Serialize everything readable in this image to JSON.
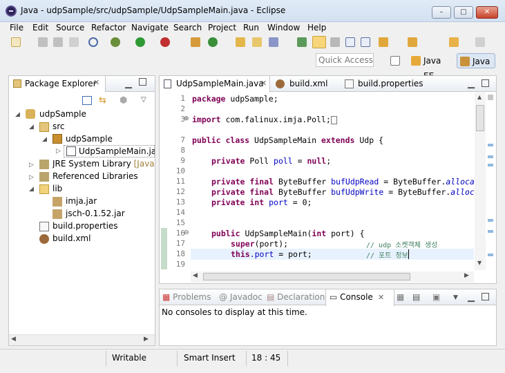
{
  "window": {
    "title": "Java - udpSample/src/udpSample/UdpSampleMain.java - Eclipse",
    "min": "–",
    "max": "□",
    "close": "✕"
  },
  "menu": [
    "File",
    "Edit",
    "Source",
    "Refactor",
    "Navigate",
    "Search",
    "Project",
    "Run",
    "Window",
    "Help"
  ],
  "quick_access": {
    "placeholder": "Quick Access"
  },
  "perspectives": [
    {
      "label": "Java EE"
    },
    {
      "label": "Java"
    }
  ],
  "package_explorer": {
    "title": "Package Explorer",
    "tree": [
      {
        "label": "udpSample"
      },
      {
        "label": "src"
      },
      {
        "label": "udpSample"
      },
      {
        "label": "UdpSampleMain.java"
      },
      {
        "label": "JRE System Library",
        "suffix": "[JavaSE-"
      },
      {
        "label": "Referenced Libraries"
      },
      {
        "label": "lib"
      },
      {
        "label": "imja.jar"
      },
      {
        "label": "jsch-0.1.52.jar"
      },
      {
        "label": "build.properties"
      },
      {
        "label": "build.xml"
      }
    ]
  },
  "editor": {
    "tabs": [
      {
        "label": "UdpSampleMain.java"
      },
      {
        "label": "build.xml"
      },
      {
        "label": "build.properties"
      }
    ],
    "line_numbers": [
      "1",
      "2",
      "3",
      "7",
      "8",
      "9",
      "10",
      "11",
      "12",
      "13",
      "14",
      "15",
      "16",
      "17",
      "18",
      "19"
    ],
    "code": {
      "l1_kw": "package",
      "l1_rest": " udpSample;",
      "l3_kw": "import",
      "l3_rest": " com.falinux.imja.Poll;",
      "l7_kw1": "public",
      "l7_kw2": "class",
      "l7_name": " UdpSampleMain ",
      "l7_kw3": "extends",
      "l7_rest": " Udp {",
      "l9_kw": "private",
      "l9_type": " Poll ",
      "l9_fld": "poll",
      "l9_eq": " = ",
      "l9_null": "null",
      "l9_end": ";",
      "l11_kw1": "private",
      "l11_kw2": "final",
      "l11_type": " ByteBuffer ",
      "l11_fld": "bufUdpRead",
      "l11_eq": " = ByteBuffer.",
      "l11_st": "allocate",
      "l12_kw1": "private",
      "l12_kw2": "final",
      "l12_type": " ByteBuffer ",
      "l12_fld": "bufUdpWrite",
      "l12_eq": " = ByteBuffer.",
      "l12_st": "allocate",
      "l13_kw1": "private",
      "l13_kw2": "int",
      "l13_fld": " port",
      "l13_end": " = 0;",
      "l16_kw": "public",
      "l16_name": " UdpSampleMain(",
      "l16_int": "int",
      "l16_rest": " port) {",
      "l17_kw": "super",
      "l17_rest": "(port);",
      "l17_cm": "// udp 소켓객체 생성",
      "l18_kw": "this",
      "l18_fld": ".port",
      "l18_rest": " = port;",
      "l18_cm": "// 포트 정보"
    }
  },
  "console": {
    "tabs": [
      {
        "label": "Problems"
      },
      {
        "label": "Javadoc"
      },
      {
        "label": "Declaration"
      },
      {
        "label": "Console"
      }
    ],
    "message": "No consoles to display at this time."
  },
  "status": {
    "writable": "Writable",
    "insert_mode": "Smart Insert",
    "position": "18 : 45"
  },
  "colors": {
    "keyword": "#7f0055",
    "field": "#0000c0",
    "comment": "#3f7f5f",
    "current_line": "#e8f2fe"
  }
}
